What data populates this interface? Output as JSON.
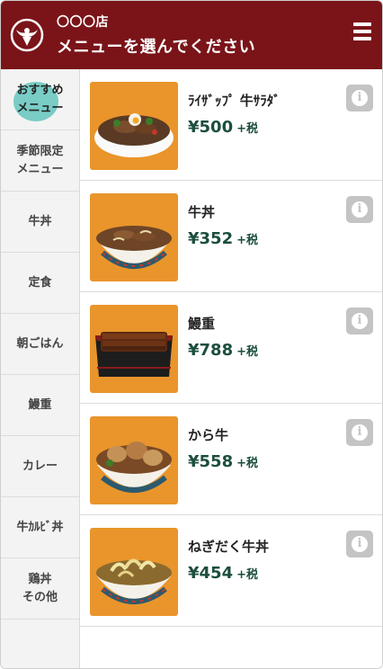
{
  "header": {
    "store_name": "〇〇〇店",
    "title": "メニューを選んでください",
    "logo_icon": "bull-logo-icon",
    "menu_icon": "hamburger-menu-icon"
  },
  "colors": {
    "header_bg": "#7a1419",
    "accent_teal": "#73c9c3",
    "price_green": "#1c4e3e",
    "thumb_orange": "#e9952b",
    "info_gray": "#c4c4c4"
  },
  "sidebar": {
    "items": [
      {
        "label": "おすすめ\nメニュー",
        "active": true
      },
      {
        "label": "季節限定\nメニュー",
        "active": false
      },
      {
        "label": "牛丼",
        "active": false
      },
      {
        "label": "定食",
        "active": false
      },
      {
        "label": "朝ごはん",
        "active": false
      },
      {
        "label": "鰻重",
        "active": false
      },
      {
        "label": "カレー",
        "active": false
      },
      {
        "label": "牛ｶﾙﾋﾞ丼",
        "active": false
      },
      {
        "label": "鶏丼\nその他",
        "active": false
      }
    ]
  },
  "menu": {
    "items": [
      {
        "name": "ﾗｲｻﾞｯﾌﾟ 牛ｻﾗﾀﾞ",
        "price": "¥500",
        "tax": "+税",
        "icon": "salad-bowl-icon"
      },
      {
        "name": "牛丼",
        "price": "¥352",
        "tax": "+税",
        "icon": "gyudon-bowl-icon"
      },
      {
        "name": "鰻重",
        "price": "¥788",
        "tax": "+税",
        "icon": "unaju-box-icon"
      },
      {
        "name": "から牛",
        "price": "¥558",
        "tax": "+税",
        "icon": "karagyu-bowl-icon"
      },
      {
        "name": "ねぎだく牛丼",
        "price": "¥454",
        "tax": "+税",
        "icon": "negidaku-bowl-icon"
      }
    ],
    "info_icon": "info-icon"
  }
}
